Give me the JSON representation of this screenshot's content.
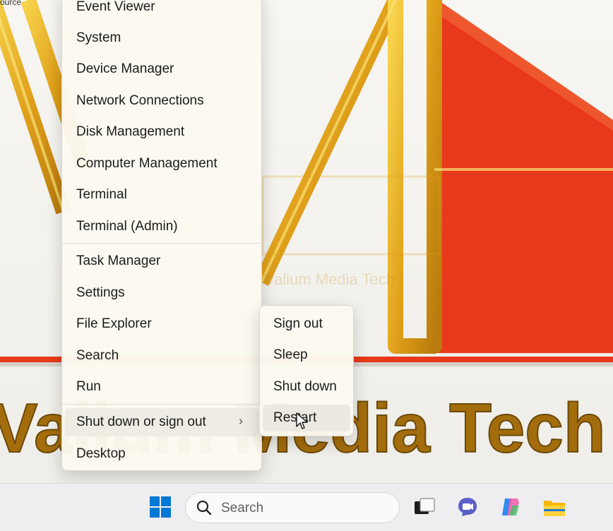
{
  "wallpaper": {
    "corner_label": "ource",
    "brand_watermark": "Valium Media Tech",
    "brand_bottom_text": "Valium Media Tech",
    "colors": {
      "gold": "#e6a91c",
      "red": "#e8391c",
      "dark_red": "#c8260f"
    }
  },
  "context_menu": {
    "items": [
      {
        "label": "Event Viewer"
      },
      {
        "label": "System"
      },
      {
        "label": "Device Manager"
      },
      {
        "label": "Network Connections"
      },
      {
        "label": "Disk Management"
      },
      {
        "label": "Computer Management"
      },
      {
        "label": "Terminal"
      },
      {
        "label": "Terminal (Admin)"
      },
      {
        "label": "Task Manager"
      },
      {
        "label": "Settings"
      },
      {
        "label": "File Explorer"
      },
      {
        "label": "Search"
      },
      {
        "label": "Run"
      },
      {
        "label": "Shut down or sign out",
        "has_submenu": true,
        "chevron": "›"
      },
      {
        "label": "Desktop"
      }
    ]
  },
  "submenu": {
    "items": [
      {
        "label": "Sign out"
      },
      {
        "label": "Sleep"
      },
      {
        "label": "Shut down"
      },
      {
        "label": "Restart",
        "hovered": true
      }
    ]
  },
  "taskbar": {
    "search_placeholder": "Search",
    "icons": [
      "windows-start-icon",
      "search-icon",
      "task-view-icon",
      "chat-icon",
      "copilot-icon",
      "file-explorer-icon"
    ],
    "accent": "#0067c0"
  }
}
